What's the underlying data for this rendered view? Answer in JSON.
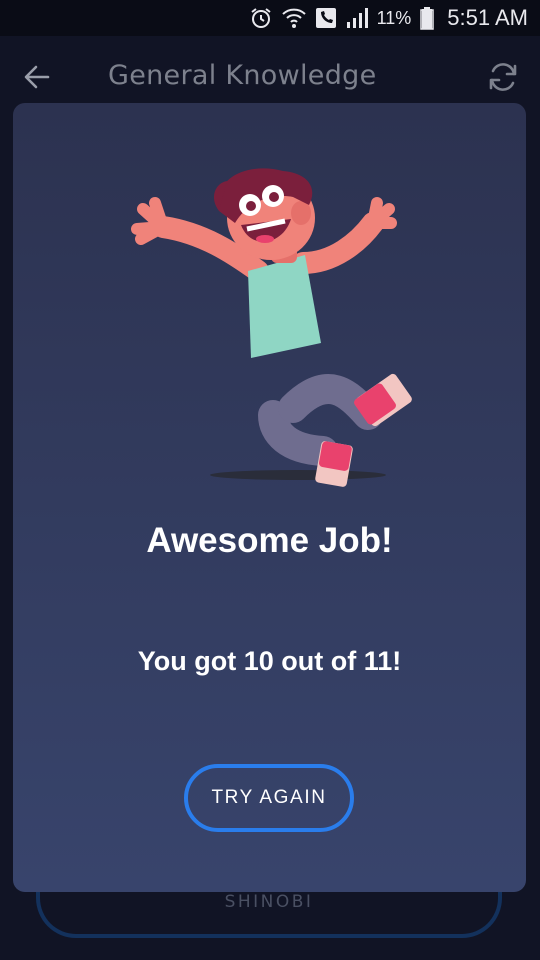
{
  "status_bar": {
    "battery": "11%",
    "time": "5:51 AM",
    "icons": [
      "alarm-icon",
      "wifi-icon",
      "phone-icon",
      "signal-icon",
      "battery-icon"
    ]
  },
  "header": {
    "title": "General Knowledge",
    "back_icon": "back-arrow-icon",
    "refresh_icon": "refresh-icon"
  },
  "background": {
    "answer_label": "SHINOBI"
  },
  "modal": {
    "illustration": "jumping-person-illustration",
    "title": "Awesome Job!",
    "score_text": "You got 10 out of 11!",
    "button_label": "TRY AGAIN"
  },
  "colors": {
    "background": "#111425",
    "modal_top": "#2c3250",
    "modal_bottom": "#38446c",
    "button_border": "#2a7dec",
    "header_text": "#7d818d"
  }
}
